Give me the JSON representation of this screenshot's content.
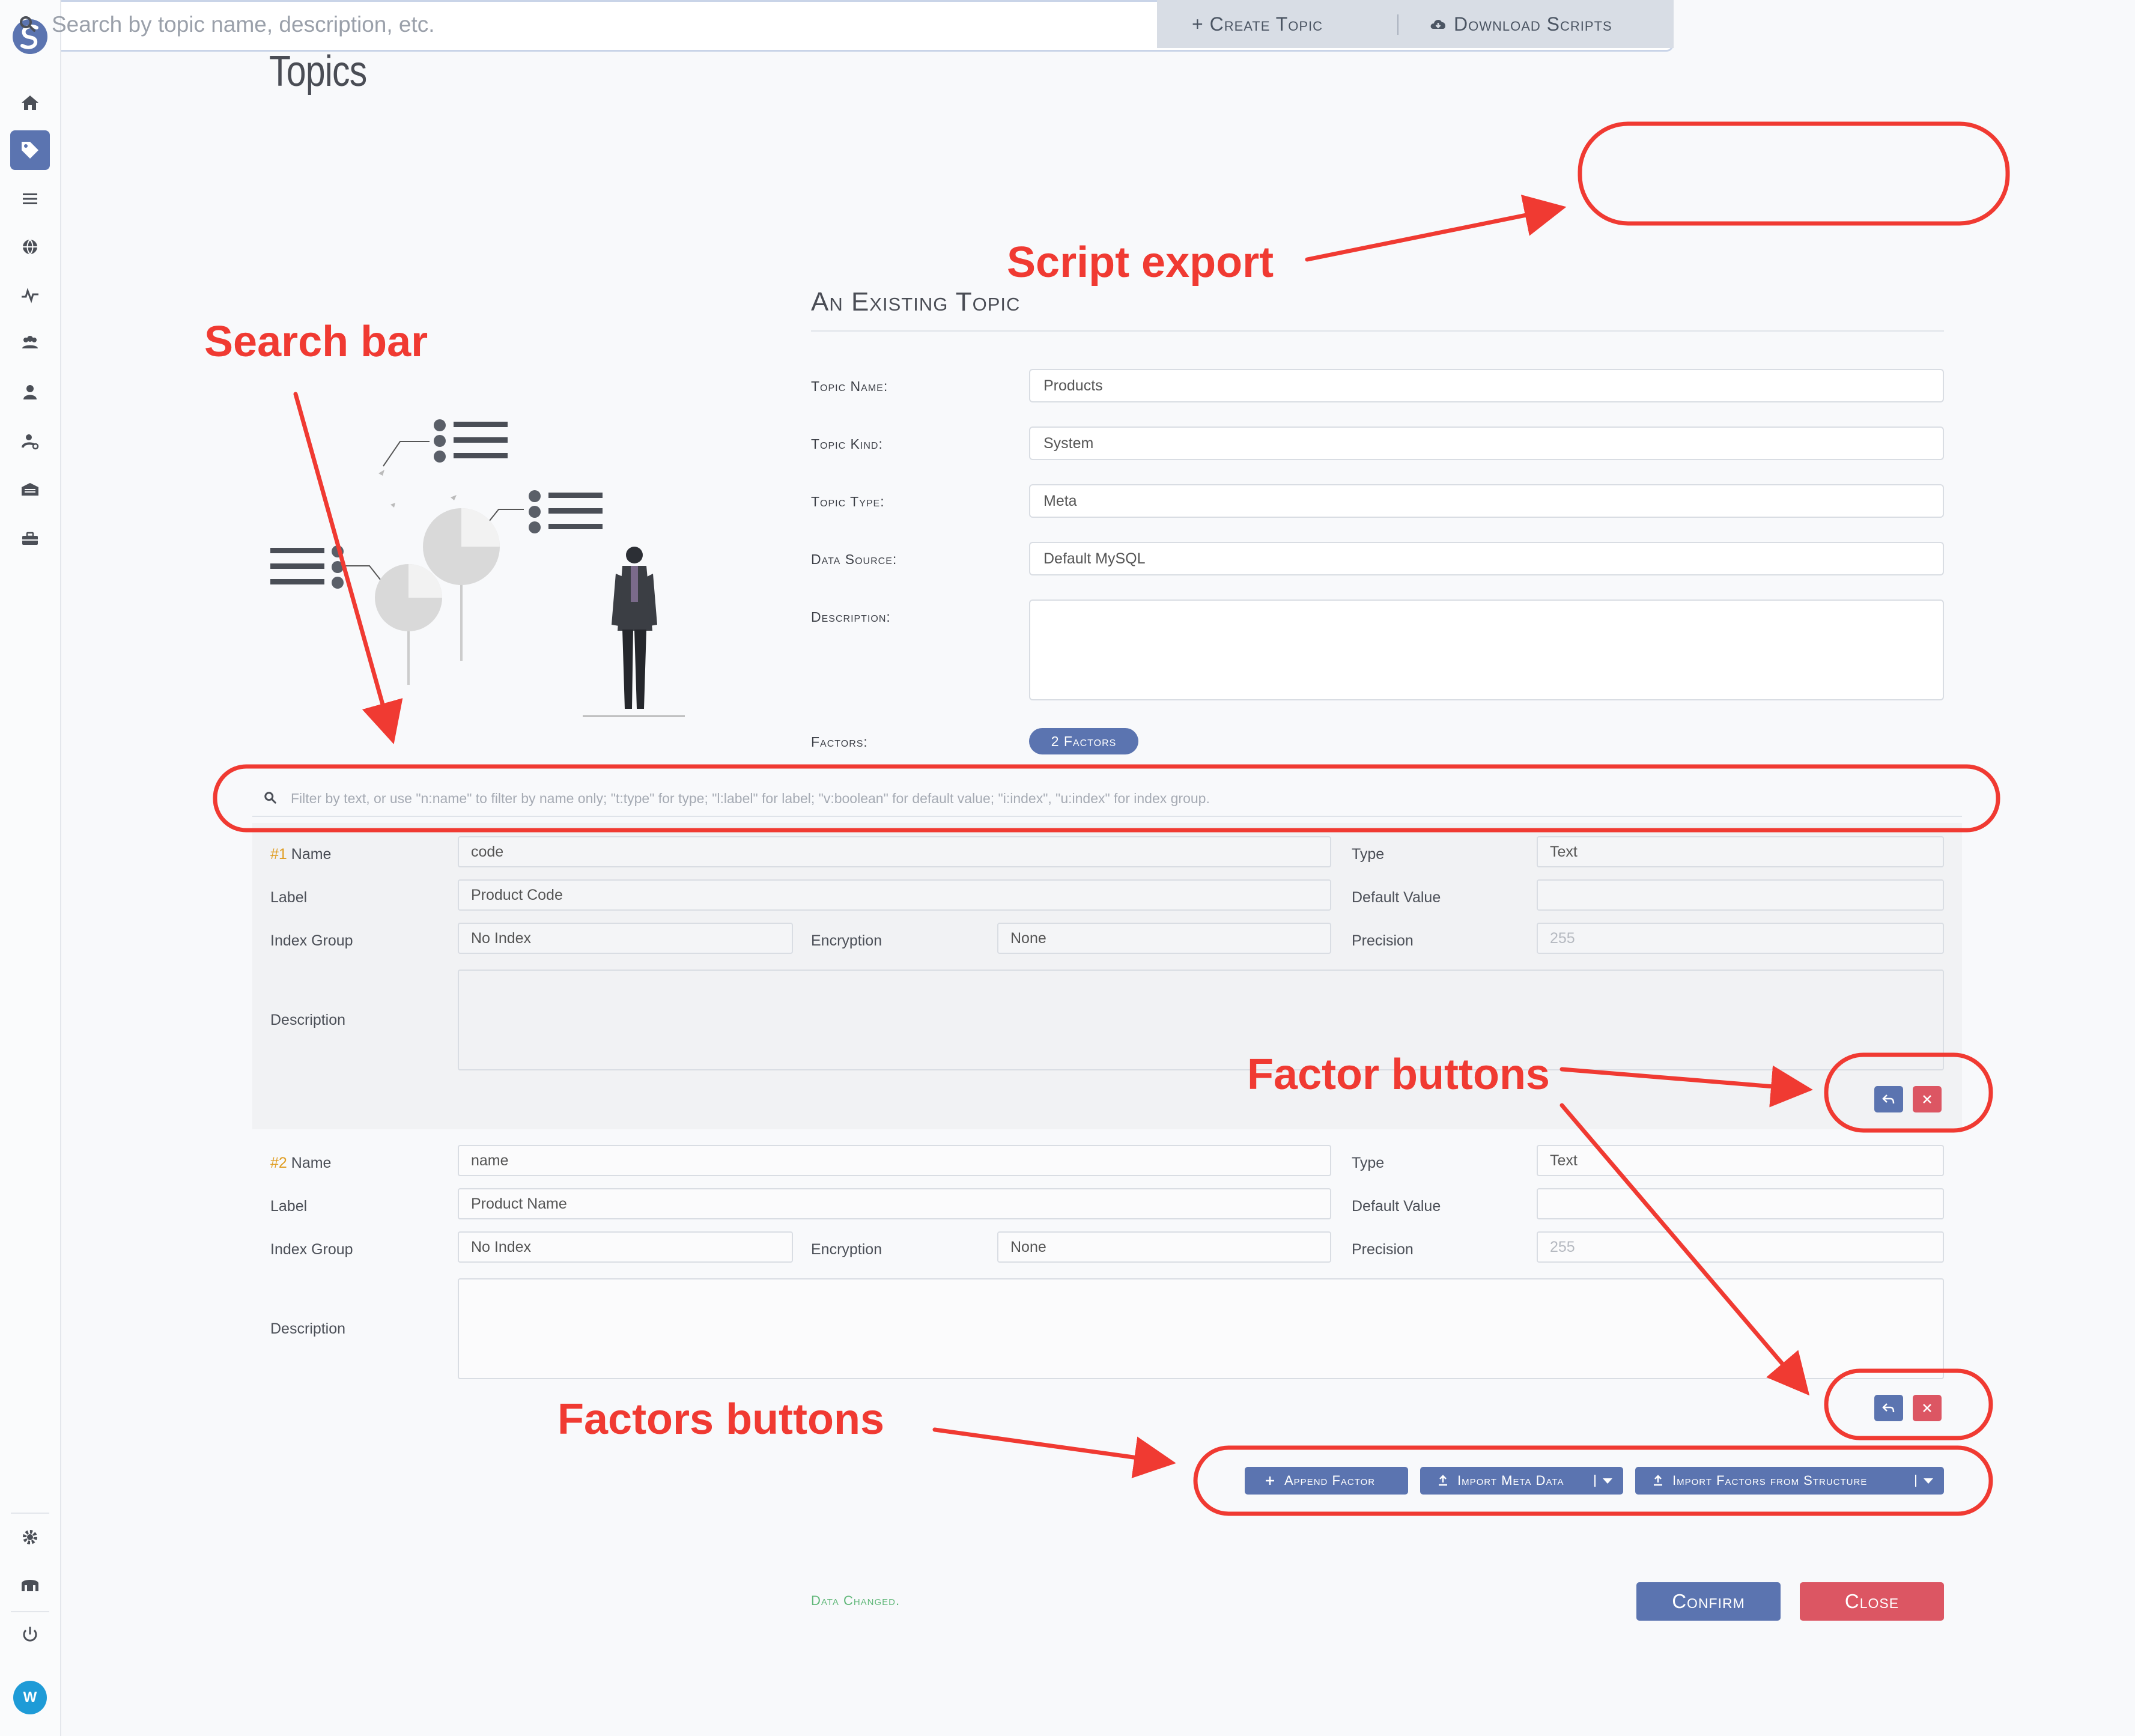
{
  "page": {
    "title": "Topics"
  },
  "search": {
    "placeholder": "Search by topic name, description, etc.",
    "create_label": "+ Create Topic",
    "download_label": "Download Scripts"
  },
  "nav": {
    "items": [
      "home-icon",
      "tag-icon",
      "list-icon",
      "globe-icon",
      "pulse-icon",
      "users-icon",
      "user-icon",
      "user-cog-icon",
      "warehouse-icon",
      "toolbox-icon",
      "gear-icon",
      "bank-icon",
      "power-icon"
    ],
    "avatar": "W"
  },
  "topic": {
    "section_title": "An Existing Topic",
    "name_label": "Topic Name:",
    "name_value": "Products",
    "kind_label": "Topic Kind:",
    "kind_value": "System",
    "type_label": "Topic Type:",
    "type_value": "Meta",
    "source_label": "Data Source:",
    "source_value": "Default MySQL",
    "description_label": "Description:",
    "description_value": "",
    "factors_label": "Factors:",
    "factors_badge": "2 Factors"
  },
  "factor_filter": {
    "placeholder": "Filter by text, or use \"n:name\" to filter by name only; \"t:type\" for type; \"l:label\" for label; \"v:boolean\" for default value; \"i:index\", \"u:index\" for index group."
  },
  "factor_labels": {
    "name": "Name",
    "type": "Type",
    "label": "Label",
    "default_value": "Default Value",
    "index_group": "Index Group",
    "encryption": "Encryption",
    "precision": "Precision",
    "description": "Description"
  },
  "factors": [
    {
      "number": "#1",
      "name": "code",
      "type": "Text",
      "label": "Product Code",
      "default_value": "",
      "index_group": "No Index",
      "encryption": "None",
      "precision": "255"
    },
    {
      "number": "#2",
      "name": "name",
      "type": "Text",
      "label": "Product Name",
      "default_value": "",
      "index_group": "No Index",
      "encryption": "None",
      "precision": "255"
    }
  ],
  "toolbar": {
    "append": "Append Factor",
    "import_meta": "Import Meta Data",
    "import_structure": "Import Factors from Structure"
  },
  "footer": {
    "status": "Data Changed.",
    "confirm": "Confirm",
    "close": "Close"
  },
  "annotations": {
    "script_export": "Script export",
    "search_bar": "Search bar",
    "factor_buttons": "Factor buttons",
    "factors_buttons": "Factors buttons",
    "color": "#f03a32"
  },
  "colors": {
    "accent": "#5b74b0",
    "danger": "#dc5663",
    "success": "#62b87a",
    "highlight": "#e09e24"
  }
}
